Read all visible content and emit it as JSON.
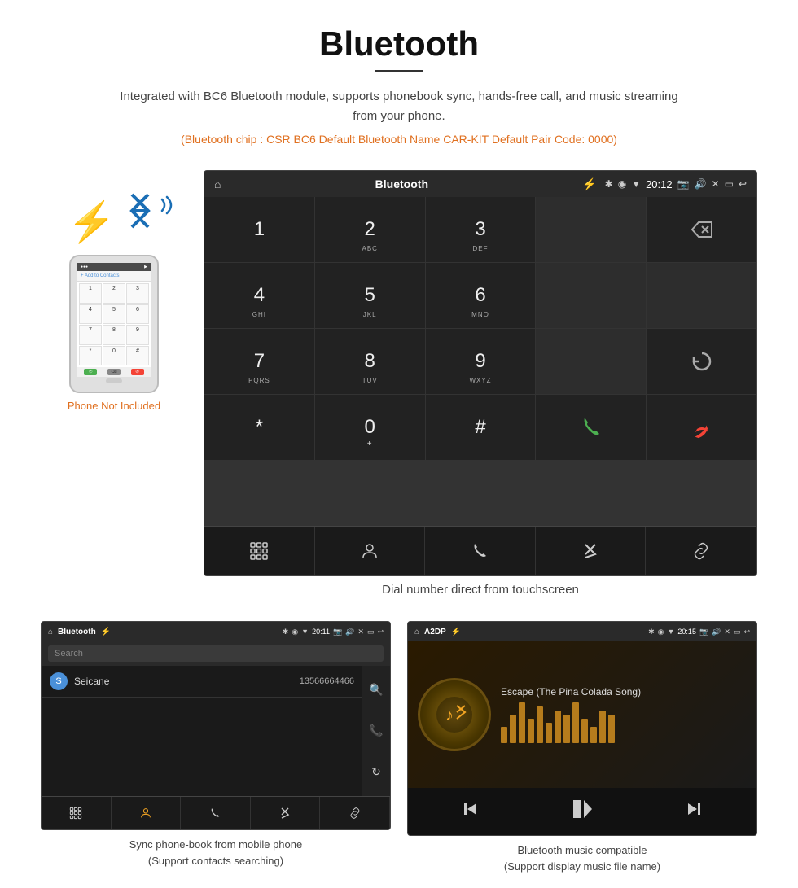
{
  "header": {
    "title": "Bluetooth",
    "description": "Integrated with BC6 Bluetooth module, supports phonebook sync, hands-free call, and music streaming from your phone.",
    "specs": "(Bluetooth chip : CSR BC6    Default Bluetooth Name CAR-KIT    Default Pair Code: 0000)"
  },
  "carScreen": {
    "title": "Bluetooth",
    "time": "20:12",
    "dialpad": {
      "keys": [
        {
          "main": "1",
          "sub": ""
        },
        {
          "main": "2",
          "sub": "ABC"
        },
        {
          "main": "3",
          "sub": "DEF"
        },
        {
          "main": "",
          "sub": ""
        },
        {
          "main": "⌫",
          "sub": ""
        },
        {
          "main": "4",
          "sub": "GHI"
        },
        {
          "main": "5",
          "sub": "JKL"
        },
        {
          "main": "6",
          "sub": "MNO"
        },
        {
          "main": "",
          "sub": ""
        },
        {
          "main": "",
          "sub": ""
        },
        {
          "main": "7",
          "sub": "PQRS"
        },
        {
          "main": "8",
          "sub": "TUV"
        },
        {
          "main": "9",
          "sub": "WXYZ"
        },
        {
          "main": "",
          "sub": ""
        },
        {
          "main": "↻",
          "sub": ""
        },
        {
          "main": "*",
          "sub": ""
        },
        {
          "main": "0",
          "sub": "+"
        },
        {
          "main": "#",
          "sub": ""
        },
        {
          "main": "📞",
          "sub": ""
        },
        {
          "main": "📞",
          "sub": ""
        }
      ]
    },
    "bottomNav": [
      "⊞",
      "👤",
      "📞",
      "✱",
      "🔗"
    ]
  },
  "mainCaption": "Dial number direct from touchscreen",
  "phonebookScreen": {
    "title": "Bluetooth",
    "time": "20:11",
    "searchPlaceholder": "Search",
    "contacts": [
      {
        "letter": "S",
        "name": "Seicane",
        "number": "13566664466"
      }
    ],
    "sideIcons": [
      "🔍",
      "📞",
      "↻"
    ],
    "bottomNav": [
      "⊞",
      "👤",
      "📞",
      "✱",
      "🔗"
    ]
  },
  "phonebookCaption": "Sync phone-book from mobile phone\n(Support contacts searching)",
  "musicScreen": {
    "title": "A2DP",
    "time": "20:15",
    "songTitle": "Escape (The Pina Colada Song)",
    "eqBars": [
      20,
      35,
      50,
      30,
      45,
      25,
      40,
      35,
      50,
      30,
      20,
      40,
      35
    ],
    "controls": [
      "⏮",
      "▶⏸",
      "⏭"
    ]
  },
  "musicCaption": "Bluetooth music compatible\n(Support display music file name)"
}
